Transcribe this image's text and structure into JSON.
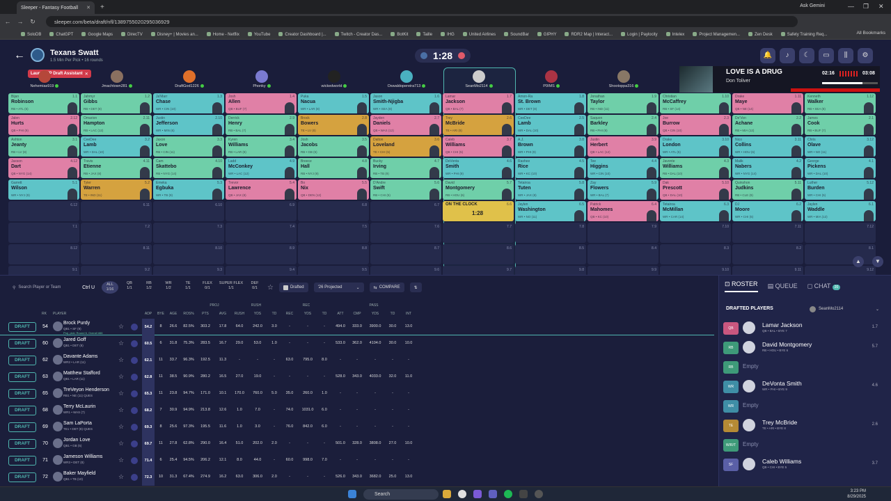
{
  "browser": {
    "tab_title": "Sleeper - Fantasy Football",
    "url": "sleeper.com/beta/draft/nfl/1389755020295036929",
    "ask_gemini": "Ask Gemini",
    "bookmarks": [
      "SoloDB",
      "ChatGPT",
      "Google Maps",
      "DirecTV",
      "Disney+ | Movies an...",
      "Home - Netflix",
      "YouTube",
      "Creator Dashboard |...",
      "Twitch - Creator Das...",
      "BotKit",
      "Taille",
      "IHG",
      "United Airlines",
      "SoundBar",
      "GIPHY",
      "RDR2 Map | Interact...",
      "Login | Paylocity",
      "Intelex",
      "Project Managemen...",
      "Zen Desk",
      "Safety Training Req..."
    ],
    "all_bookmarks": "All Bookmarks"
  },
  "header": {
    "league_name": "Texans Swatt",
    "league_sub": "1.5 Min Per Pick • 16 rounds",
    "timer": "1:28",
    "fp_assistant": "Launch FP Draft Assistant"
  },
  "media": {
    "title": "LOVE IS A DRUG",
    "artist": "Don Toliver",
    "current": "02:16",
    "duration": "03:08",
    "progress": 0.72
  },
  "teams": [
    "Nehemias919",
    "Jmachtown281",
    "DraftGod1226",
    "Phonky",
    "wickedworld",
    "Oswaldopereira713",
    "SeanMo2114",
    "P0IMS",
    "Shootoppa316",
    "",
    "",
    ""
  ],
  "board": [
    [
      [
        "Bijan",
        "Robinson",
        "RB • ATL (5)",
        "1.1",
        "rb"
      ],
      [
        "Jahmyr",
        "Gibbs",
        "RB • DET (8)",
        "1.2",
        "rb"
      ],
      [
        "Ja'Marr",
        "Chase",
        "WR • CIN (10)",
        "1.3",
        "wr"
      ],
      [
        "Josh",
        "Allen",
        "QB • BUF (7)",
        "1.4",
        "qb"
      ],
      [
        "Puka",
        "Nacua",
        "WR • LAR (8)",
        "1.5",
        "wr"
      ],
      [
        "Jason",
        "Smith-Njigba",
        "WR • SEA (8)",
        "1.6",
        "wr"
      ],
      [
        "Lamar",
        "Jackson",
        "QB • BAL (7)",
        "1.7",
        "qb"
      ],
      [
        "Amon-Ra",
        "St. Brown",
        "WR • DET (8)",
        "1.8",
        "wr"
      ],
      [
        "Jonathan",
        "Taylor",
        "RB • IND (11)",
        "1.9",
        "rb"
      ],
      [
        "Christian",
        "McCaffrey",
        "RB • SF (14)",
        "1.10",
        "rb"
      ],
      [
        "Drake",
        "Maye",
        "QB • NE (14)",
        "1.11",
        "qb"
      ],
      [
        "Kenneth",
        "Walker",
        "RB • SEA (8)",
        "1.12",
        "rb"
      ]
    ],
    [
      [
        "Jalen",
        "Hurts",
        "QB • PHI (9)",
        "2.12",
        "qb"
      ],
      [
        "Omarion",
        "Hampton",
        "RB • LAC (12)",
        "2.11",
        "rb"
      ],
      [
        "Justin",
        "Jefferson",
        "WR • MIN (6)",
        "2.10",
        "wr"
      ],
      [
        "Derrick",
        "Henry",
        "RB • BAL (7)",
        "2.9",
        "rb"
      ],
      [
        "Brock",
        "Bowers",
        "TE • LV (8)",
        "2.8",
        "te"
      ],
      [
        "Jayden",
        "Daniels",
        "QB • WAS (12)",
        "2.7",
        "qb"
      ],
      [
        "Trey",
        "McBride",
        "TE • ARI (8)",
        "2.6",
        "te"
      ],
      [
        "CeeDee",
        "Lamb",
        "WR • DAL (10)",
        "2.5",
        "wr"
      ],
      [
        "Saquon",
        "Barkley",
        "RB • PHI (9)",
        "2.4",
        "rb"
      ],
      [
        "Joe",
        "Burrow",
        "QB • CIN (10)",
        "2.3",
        "qb"
      ],
      [
        "De'Von",
        "Achane",
        "RB • MIA (12)",
        "2.2",
        "rb"
      ],
      [
        "James",
        "Cook",
        "RB • BUF (7)",
        "2.1",
        "rb"
      ]
    ],
    [
      [
        "Ashton",
        "Jeanty",
        "RB • LV (8)",
        "3.1",
        "rb"
      ],
      [
        "CeeDee",
        "Lamb",
        "WR • DAL (10)",
        "3.2",
        "wr"
      ],
      [
        "Jaxon",
        "Love",
        "RB • CIN (11)",
        "3.3",
        "rb"
      ],
      [
        "Kyren",
        "Williams",
        "RB • LAR (8)",
        "3.4",
        "rb"
      ],
      [
        "Josh",
        "Jacobs",
        "RB • GB (5)",
        "3.5",
        "rb"
      ],
      [
        "Dalton",
        "Loveland",
        "TE • CHI (5)",
        "3.6",
        "te"
      ],
      [
        "Caleb",
        "Williams",
        "QB • CHI (5)",
        "3.7",
        "qb"
      ],
      [
        "A.J.",
        "Brown",
        "WR • PHI (9)",
        "3.8",
        "wr"
      ],
      [
        "Justin",
        "Herbert",
        "QB • LAC (12)",
        "3.9",
        "qb"
      ],
      [
        "Drake",
        "London",
        "WR • ATL (5)",
        "3.10",
        "wr"
      ],
      [
        "Nico",
        "Collins",
        "WR • HOU (6)",
        "3.11",
        "wr"
      ],
      [
        "Chris",
        "Olave",
        "WR • NO (11)",
        "3.12",
        "wr"
      ]
    ],
    [
      [
        "Jaxson",
        "Dart",
        "QB • NYG (14)",
        "4.12",
        "qb"
      ],
      [
        "Travis",
        "Etienne",
        "RB • JAX (8)",
        "4.11",
        "rb"
      ],
      [
        "Cam",
        "Skattebo",
        "RB • NYG (14)",
        "4.10",
        "rb"
      ],
      [
        "Ladd",
        "McConkey",
        "WR • LAC (12)",
        "4.9",
        "wr"
      ],
      [
        "Breece",
        "Hall",
        "RB • NYJ (9)",
        "4.8",
        "rb"
      ],
      [
        "Bucky",
        "Irving",
        "RB • TB (9)",
        "4.7",
        "rb"
      ],
      [
        "DeVonta",
        "Smith",
        "WR • PHI (9)",
        "4.6",
        "wr"
      ],
      [
        "Rashee",
        "Rice",
        "WR • KC (10)",
        "4.5",
        "wr"
      ],
      [
        "Tee",
        "Higgins",
        "WR • CIN (10)",
        "4.4",
        "wr"
      ],
      [
        "Javonte",
        "Williams",
        "RB • DAL (10)",
        "4.3",
        "rb"
      ],
      [
        "Malik",
        "Nabers",
        "WR • NYG (14)",
        "4.2",
        "wr"
      ],
      [
        "George",
        "Pickens",
        "WR • DAL (10)",
        "4.1",
        "wr"
      ]
    ],
    [
      [
        "Garrett",
        "Wilson",
        "WR • NYJ (9)",
        "5.1",
        "wr"
      ],
      [
        "Tyler",
        "Warren",
        "TE • IND (11)",
        "5.2",
        "te"
      ],
      [
        "Emeka",
        "Egbuka",
        "WR • TB (9)",
        "5.3",
        "wr"
      ],
      [
        "Trevor",
        "Lawrence",
        "QB • JAX (8)",
        "5.4",
        "qb"
      ],
      [
        "Bo",
        "Nix",
        "QB • DEN (12)",
        "5.5",
        "qb"
      ],
      [
        "D'Andre",
        "Swift",
        "RB • CHI (5)",
        "5.6",
        "rb"
      ],
      [
        "David",
        "Montgomery",
        "RB • HOU (6)",
        "5.7",
        "rb"
      ],
      [
        "Tetairoa",
        "Tuten",
        "WR • JAX (8)",
        "5.8",
        "wr"
      ],
      [
        "Zay",
        "Flowers",
        "WR • BAL (7)",
        "5.9",
        "wr"
      ],
      [
        "Dak",
        "Prescott",
        "QB • DAL (10)",
        "5.10",
        "qb"
      ],
      [
        "Quinshon",
        "Judkins",
        "RB • CLE (9)",
        "5.11",
        "rb"
      ],
      [
        "Luther",
        "Burden",
        "WR • CHI (5)",
        "5.12",
        "wr"
      ]
    ],
    [
      [
        "",
        "",
        "",
        "6.12",
        "empty"
      ],
      [
        "",
        "",
        "",
        "6.11",
        "empty"
      ],
      [
        "",
        "",
        "",
        "6.10",
        "empty"
      ],
      [
        "",
        "",
        "",
        "6.9",
        "empty"
      ],
      [
        "",
        "",
        "",
        "6.8",
        "empty"
      ],
      [
        "",
        "",
        "",
        "6.7",
        "empty"
      ],
      [
        "ON THE CLOCK",
        "1:28",
        "",
        "6.6",
        "otc"
      ],
      [
        "Jaylen",
        "Washington",
        "WR • NO (11)",
        "6.5",
        "wr"
      ],
      [
        "Patrick",
        "Mahomes",
        "QB • KC (10)",
        "6.4",
        "qb"
      ],
      [
        "Tetairoa",
        "McMillan",
        "WR • CAR (14)",
        "6.3",
        "wr"
      ],
      [
        "DJ",
        "Moore",
        "WR • CHI (5)",
        "6.2",
        "wr"
      ],
      [
        "Jaylen",
        "Waddle",
        "WR • MIA (12)",
        "6.1",
        "wr"
      ]
    ],
    [
      [
        "",
        "",
        "",
        "7.1",
        "empty"
      ],
      [
        "",
        "",
        "",
        "7.2",
        "empty"
      ],
      [
        "",
        "",
        "",
        "7.3",
        "empty"
      ],
      [
        "",
        "",
        "",
        "7.4",
        "empty"
      ],
      [
        "",
        "",
        "",
        "7.5",
        "empty"
      ],
      [
        "",
        "",
        "",
        "7.6",
        "empty"
      ],
      [
        "",
        "",
        "",
        "7.7",
        "empty"
      ],
      [
        "",
        "",
        "",
        "7.8",
        "empty"
      ],
      [
        "",
        "",
        "",
        "7.9",
        "empty"
      ],
      [
        "",
        "",
        "",
        "7.10",
        "empty"
      ],
      [
        "",
        "",
        "",
        "7.11",
        "empty"
      ],
      [
        "",
        "",
        "",
        "7.12",
        "empty"
      ]
    ],
    [
      [
        "",
        "",
        "",
        "8.12",
        "empty"
      ],
      [
        "",
        "",
        "",
        "8.11",
        "empty"
      ],
      [
        "",
        "",
        "",
        "8.10",
        "empty"
      ],
      [
        "",
        "",
        "",
        "8.9",
        "empty"
      ],
      [
        "",
        "",
        "",
        "8.8",
        "empty"
      ],
      [
        "",
        "",
        "",
        "8.7",
        "empty"
      ],
      [
        "",
        "",
        "",
        "8.6",
        "empty"
      ],
      [
        "",
        "",
        "",
        "8.5",
        "empty"
      ],
      [
        "",
        "",
        "",
        "8.4",
        "empty"
      ],
      [
        "",
        "",
        "",
        "8.3",
        "empty"
      ],
      [
        "",
        "",
        "",
        "8.2",
        "empty"
      ],
      [
        "",
        "",
        "",
        "8.1",
        "empty"
      ]
    ],
    [
      [
        "",
        "",
        "",
        "9.1",
        "empty"
      ],
      [
        "",
        "",
        "",
        "9.2",
        "empty"
      ],
      [
        "",
        "",
        "",
        "9.3",
        "empty"
      ],
      [
        "",
        "",
        "",
        "9.4",
        "empty"
      ],
      [
        "",
        "",
        "",
        "9.5",
        "empty"
      ],
      [
        "",
        "",
        "",
        "9.6",
        "empty"
      ],
      [
        "",
        "",
        "",
        "9.7",
        "empty"
      ],
      [
        "",
        "",
        "",
        "9.8",
        "empty"
      ],
      [
        "",
        "",
        "",
        "9.9",
        "empty"
      ],
      [
        "",
        "",
        "",
        "9.10",
        "empty"
      ],
      [
        "",
        "",
        "",
        "9.11",
        "empty"
      ],
      [
        "",
        "",
        "",
        "9.12",
        "empty"
      ]
    ]
  ],
  "filters": {
    "search_placeholder": "Search Player or Team",
    "kbd": "Ctrl U",
    "positions": [
      [
        "ALL",
        "1/16"
      ],
      [
        "QB",
        "1/1"
      ],
      [
        "RB",
        "1/2"
      ],
      [
        "WR",
        "1/2"
      ],
      [
        "TE",
        "1/1"
      ],
      [
        "FLEX",
        "0/1"
      ],
      [
        "SUPER FLEX",
        "1/1"
      ],
      [
        "DEF",
        "0/1"
      ]
    ],
    "drafted": "Drafted",
    "projected": "'26 Projected",
    "compare": "COMPARE"
  },
  "list_header": {
    "rk": "RK",
    "player": "PLAYER",
    "group_proj": "PROJ",
    "group_rush": "RUSH",
    "group_rec": "REC",
    "group_pass": "PASS",
    "cols": [
      "ADP",
      "BYE",
      "AGE",
      "ROS%",
      "PTS",
      "AVG",
      "RUSH",
      "YDS",
      "TD",
      "REC",
      "YDS",
      "TD",
      "ATT",
      "CMP",
      "YDS",
      "TD",
      "INT"
    ]
  },
  "players": [
    {
      "rk": "54",
      "name": "Brock Purdy",
      "team": "QB1 • SF (9)",
      "proj": "Proj. pick: Round 6, Overall #66",
      "vals": [
        "54.2",
        "8",
        "26.6",
        "82.5%",
        "303.2",
        "17.8",
        "64.0",
        "242.0",
        "3.0",
        "-",
        "-",
        "-",
        "494.0",
        "333.0",
        "3900.0",
        "30.0",
        "13.0"
      ]
    },
    {
      "rk": "60",
      "name": "Jared Goff",
      "team": "QB1 • DET (8)",
      "proj": "",
      "vals": [
        "60.5",
        "6",
        "31.8",
        "75.3%",
        "283.5",
        "16.7",
        "29.0",
        "53.0",
        "1.0",
        "-",
        "-",
        "-",
        "533.0",
        "362.0",
        "4104.0",
        "30.0",
        "10.0"
      ]
    },
    {
      "rk": "62",
      "name": "Davante Adams",
      "team": "WR2 • LAR (11)",
      "proj": "",
      "vals": [
        "62.1",
        "11",
        "33.7",
        "96.3%",
        "192.5",
        "11.3",
        "-",
        "-",
        "-",
        "63.0",
        "795.0",
        "8.0",
        "-",
        "-",
        "-",
        "-",
        "-"
      ]
    },
    {
      "rk": "63",
      "name": "Matthew Stafford",
      "team": "QB1 • LAR (11)",
      "proj": "",
      "vals": [
        "62.8",
        "11",
        "38.5",
        "90.9%",
        "280.2",
        "16.5",
        "27.0",
        "19.0",
        "-",
        "-",
        "-",
        "-",
        "528.0",
        "343.0",
        "4033.0",
        "32.0",
        "11.0"
      ]
    },
    {
      "rk": "65",
      "name": "TreVeyon Henderson",
      "team": "RB1 • NE (11) QUES",
      "proj": "",
      "vals": [
        "65.3",
        "11",
        "23.8",
        "94.7%",
        "171.0",
        "10.1",
        "170.0",
        "760.0",
        "5.0",
        "35.0",
        "260.0",
        "1.0",
        "-",
        "-",
        "-",
        "-",
        "-"
      ]
    },
    {
      "rk": "68",
      "name": "Terry McLaurin",
      "team": "WR1 • WAS (7)",
      "proj": "",
      "vals": [
        "68.2",
        "7",
        "30.9",
        "94.9%",
        "213.8",
        "12.6",
        "1.0",
        "7.0",
        "-",
        "74.0",
        "1031.0",
        "6.0",
        "-",
        "-",
        "-",
        "-",
        "-"
      ]
    },
    {
      "rk": "69",
      "name": "Sam LaPorta",
      "team": "TE1 • DET (8) QUES",
      "proj": "",
      "vals": [
        "69.3",
        "8",
        "25.6",
        "97.3%",
        "195.5",
        "11.6",
        "1.0",
        "3.0",
        "-",
        "76.0",
        "842.0",
        "6.0",
        "-",
        "-",
        "-",
        "-",
        "-"
      ]
    },
    {
      "rk": "70",
      "name": "Jordan Love",
      "team": "QB1 • GB (5)",
      "proj": "",
      "vals": [
        "69.7",
        "11",
        "27.8",
        "62.8%",
        "290.0",
        "16.4",
        "51.0",
        "202.0",
        "2.0",
        "-",
        "-",
        "-",
        "501.0",
        "328.0",
        "3808.0",
        "27.0",
        "10.0"
      ]
    },
    {
      "rk": "71",
      "name": "Jameson Williams",
      "team": "WR3 • DET (8)",
      "proj": "",
      "vals": [
        "71.4",
        "6",
        "25.4",
        "94.5%",
        "206.2",
        "12.1",
        "8.0",
        "44.0",
        "-",
        "60.0",
        "998.0",
        "7.0",
        "-",
        "-",
        "-",
        "-",
        "-"
      ]
    },
    {
      "rk": "72",
      "name": "Baker Mayfield",
      "team": "QB1 • TB (10)",
      "proj": "",
      "vals": [
        "72.3",
        "10",
        "31.3",
        "67.4%",
        "274.9",
        "16.2",
        "63.0",
        "306.0",
        "2.0",
        "-",
        "-",
        "-",
        "526.0",
        "343.0",
        "3682.0",
        "25.0",
        "13.0"
      ]
    }
  ],
  "right_panel": {
    "tabs": [
      "ROSTER",
      "QUEUE",
      "CHAT"
    ],
    "chat_badge": "20",
    "drafted_header": "DRAFTED PLAYERS",
    "user": "SeanMo2114",
    "roster": [
      {
        "slot": "QB",
        "name": "Lamar Jackson",
        "sub": "QB • BAL • BYE 7",
        "pick": "1.7",
        "color": "#c9577f"
      },
      {
        "slot": "RB",
        "name": "David Montgomery",
        "sub": "RB • HOU • BYE 6",
        "pick": "5.7",
        "color": "#3e9a79"
      },
      {
        "slot": "RB",
        "name": "Empty",
        "sub": "",
        "pick": "",
        "color": "#3e9a79"
      },
      {
        "slot": "WR",
        "name": "DeVonta Smith",
        "sub": "WR • PHI • BYE 9",
        "pick": "4.6",
        "color": "#3f8ea6"
      },
      {
        "slot": "WR",
        "name": "Empty",
        "sub": "",
        "pick": "",
        "color": "#3f8ea6"
      },
      {
        "slot": "TE",
        "name": "Trey McBride",
        "sub": "TE • ARI • BYE 8",
        "pick": "2.6",
        "color": "#b58a35"
      },
      {
        "slot": "W/R/T",
        "name": "Empty",
        "sub": "",
        "pick": "",
        "color": "#3e9a79"
      },
      {
        "slot": "SF",
        "name": "Caleb Williams",
        "sub": "QB • CHI • BYE 5",
        "pick": "3.7",
        "color": "#5a5fa6"
      }
    ]
  },
  "taskbar": {
    "search": "Search",
    "time": "3:23 PM",
    "date": "8/29/2025"
  }
}
